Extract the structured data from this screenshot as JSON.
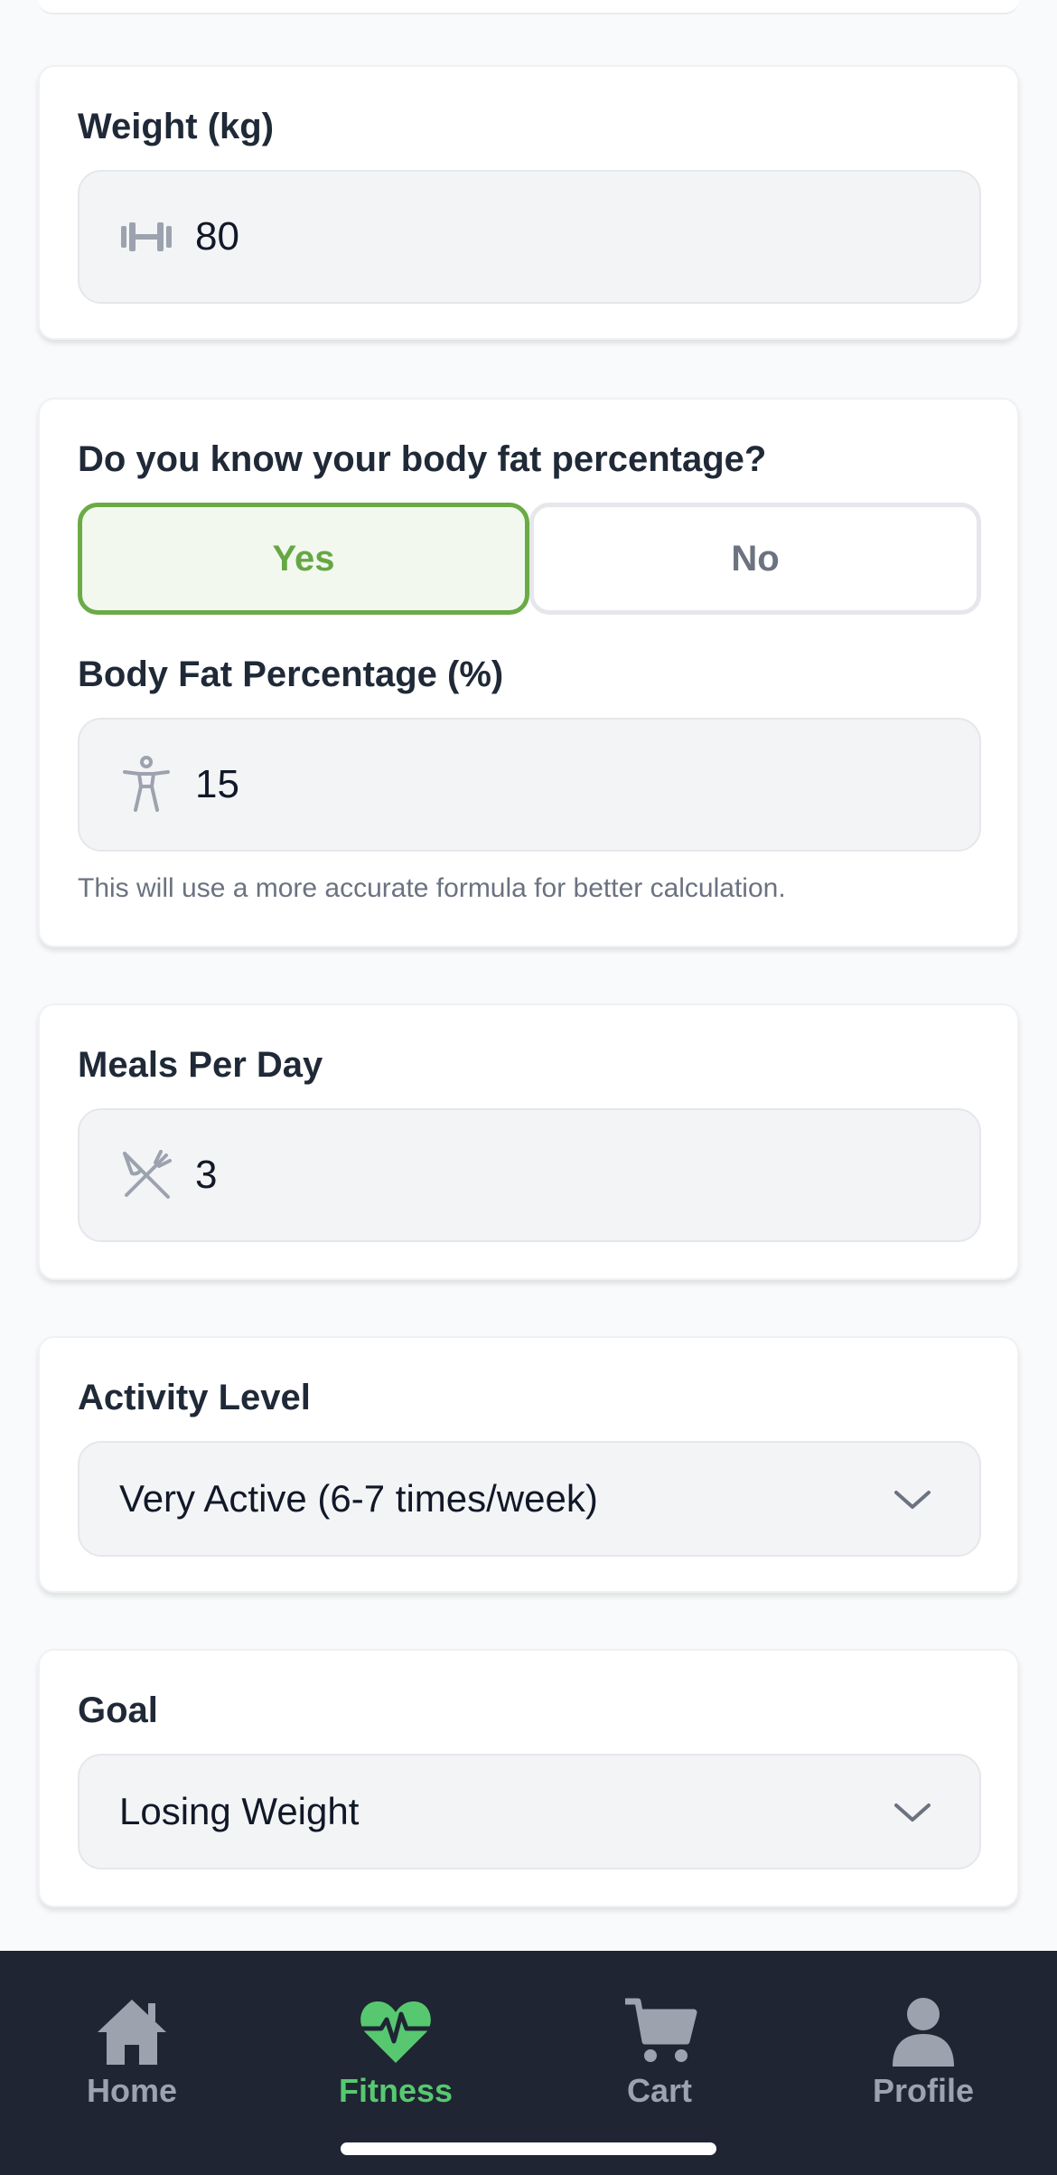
{
  "weight": {
    "label": "Weight (kg)",
    "value": "80",
    "icon": "dumbbell-icon"
  },
  "body_fat_question": {
    "label": "Do you know your body fat percentage?",
    "yes_label": "Yes",
    "no_label": "No",
    "selected": "Yes"
  },
  "body_fat": {
    "label": "Body Fat Percentage (%)",
    "value": "15",
    "icon": "person-icon",
    "helper": "This will use a more accurate formula for better calculation."
  },
  "meals": {
    "label": "Meals Per Day",
    "value": "3",
    "icon": "utensils-icon"
  },
  "activity": {
    "label": "Activity Level",
    "selected": "Very Active (6-7 times/week)"
  },
  "goal": {
    "label": "Goal",
    "selected": "Losing Weight"
  },
  "nav": {
    "items": [
      {
        "label": "Home",
        "icon": "home-icon",
        "active": false
      },
      {
        "label": "Fitness",
        "icon": "heart-pulse-icon",
        "active": true
      },
      {
        "label": "Cart",
        "icon": "cart-icon",
        "active": false
      },
      {
        "label": "Profile",
        "icon": "user-icon",
        "active": false
      }
    ]
  },
  "colors": {
    "accent_green": "#65a843",
    "nav_active": "#57c870",
    "nav_background": "#1f2533",
    "nav_inactive": "#9ca3af"
  }
}
